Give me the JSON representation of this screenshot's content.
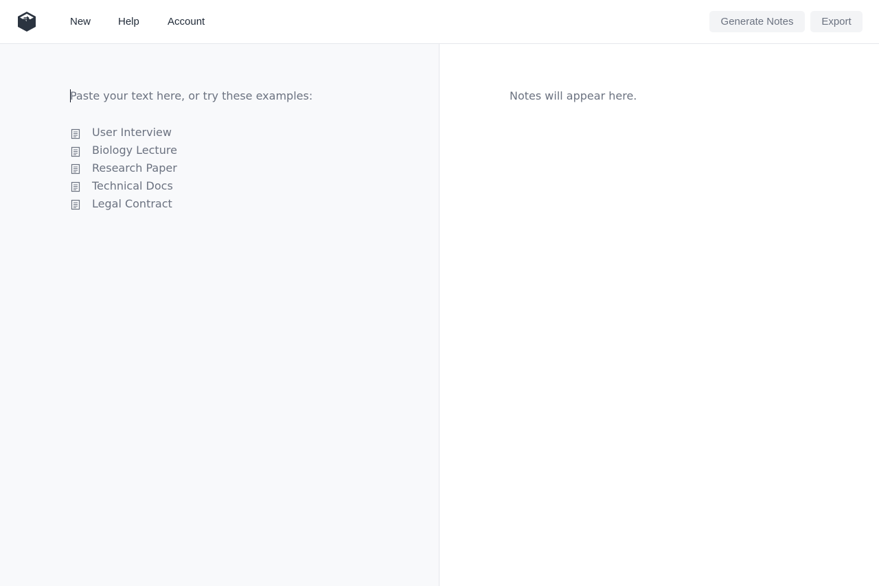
{
  "header": {
    "logo_icon": "cube-arrow-logo-icon",
    "nav": {
      "new_label": "New",
      "help_label": "Help",
      "account_label": "Account"
    },
    "actions": {
      "generate_label": "Generate Notes",
      "export_label": "Export"
    }
  },
  "editor": {
    "placeholder": "Paste your text here, or try these examples:",
    "examples": [
      {
        "label": "User Interview",
        "icon": "document-icon"
      },
      {
        "label": "Biology Lecture",
        "icon": "document-icon"
      },
      {
        "label": "Research Paper",
        "icon": "document-icon"
      },
      {
        "label": "Technical Docs",
        "icon": "document-icon"
      },
      {
        "label": "Legal Contract",
        "icon": "document-icon"
      }
    ]
  },
  "notes": {
    "placeholder": "Notes will appear here."
  },
  "colors": {
    "text_primary": "#1f2937",
    "text_muted": "#6b7280",
    "left_panel_bg": "#f8f9fb",
    "button_bg": "#f3f4f6",
    "logo": "#2b3440"
  }
}
